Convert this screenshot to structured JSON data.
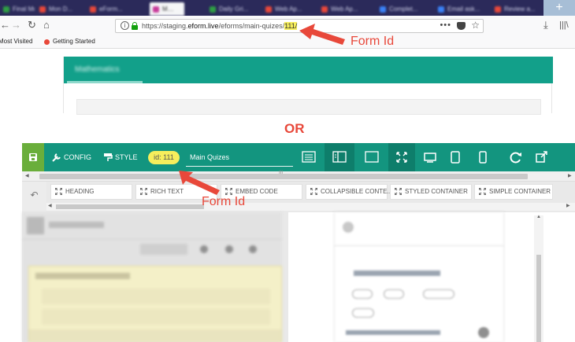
{
  "browser": {
    "tabs": [
      {
        "label": "Final Mo…",
        "color": "#2f9e44"
      },
      {
        "label": "Mon D...",
        "color": "#e8483a"
      },
      {
        "label": "eForm...",
        "color": "#e8483a"
      },
      {
        "label": "M…",
        "color": "#c73a9a"
      },
      {
        "label": "Daily Gri...",
        "color": "#2f9e44"
      },
      {
        "label": "Web Ap...",
        "color": "#e8483a"
      },
      {
        "label": "Web Ap...",
        "color": "#e8483a"
      },
      {
        "label": "Complet...",
        "color": "#3b82f6"
      },
      {
        "label": "Email ask...",
        "color": "#3b82f6"
      },
      {
        "label": "Review a...",
        "color": "#e8483a"
      }
    ],
    "new_tab_glyph": "+",
    "url": {
      "prefix": "https://staging.",
      "host": "eform.live",
      "path": "/eforms/main-quizes/",
      "highlight": "111/"
    },
    "url_menu_glyph": "•••",
    "bookmarks": [
      "Most Visited",
      "Getting Started"
    ]
  },
  "annotations": {
    "form_id_label": "Form Id",
    "or_label": "OR"
  },
  "preview": {
    "title": "Mathematics"
  },
  "toolbar": {
    "config_label": "CONFIG",
    "style_label": "STYLE",
    "id_badge": "id: 111",
    "form_name": "Main Quizes",
    "scroll_grip": "III"
  },
  "components": [
    "HEADING",
    "RICH TEXT",
    "EMBED CODE",
    "COLLAPSIBLE CONTE...",
    "STYLED CONTAINER",
    "SIMPLE CONTAINER"
  ],
  "colors": {
    "teal": "#13957f",
    "save_green": "#6aae3b",
    "highlight_yellow": "#f6ee5c",
    "annotation_red": "#e8483a"
  }
}
